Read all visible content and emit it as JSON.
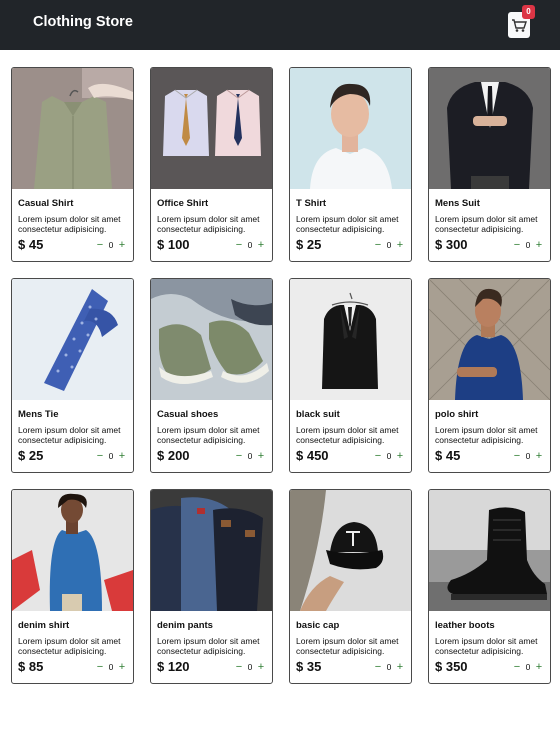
{
  "navbar": {
    "brand": "Clothing Store",
    "cart_count": "0",
    "cart_icon": "cart-icon"
  },
  "products": [
    {
      "name": "Casual Shirt",
      "desc": "Lorem ipsum dolor sit amet consectetur adipisicing.",
      "price": "$ 45",
      "qty": "0",
      "minus": "−",
      "plus": "+"
    },
    {
      "name": "Office Shirt",
      "desc": "Lorem ipsum dolor sit amet consectetur adipisicing.",
      "price": "$ 100",
      "qty": "0",
      "minus": "−",
      "plus": "+"
    },
    {
      "name": "T Shirt",
      "desc": "Lorem ipsum dolor sit amet consectetur adipisicing.",
      "price": "$ 25",
      "qty": "0",
      "minus": "−",
      "plus": "+"
    },
    {
      "name": "Mens Suit",
      "desc": "Lorem ipsum dolor sit amet consectetur adipisicing.",
      "price": "$ 300",
      "qty": "0",
      "minus": "−",
      "plus": "+"
    },
    {
      "name": "Mens Tie",
      "desc": "Lorem ipsum dolor sit amet consectetur adipisicing.",
      "price": "$ 25",
      "qty": "0",
      "minus": "−",
      "plus": "+"
    },
    {
      "name": "Casual shoes",
      "desc": "Lorem ipsum dolor sit amet consectetur adipisicing.",
      "price": "$ 200",
      "qty": "0",
      "minus": "−",
      "plus": "+"
    },
    {
      "name": "black suit",
      "desc": "Lorem ipsum dolor sit amet consectetur adipisicing.",
      "price": "$ 450",
      "qty": "0",
      "minus": "−",
      "plus": "+"
    },
    {
      "name": "polo shirt",
      "desc": "Lorem ipsum dolor sit amet consectetur adipisicing.",
      "price": "$ 45",
      "qty": "0",
      "minus": "−",
      "plus": "+"
    },
    {
      "name": "denim shirt",
      "desc": "Lorem ipsum dolor sit amet consectetur adipisicing.",
      "price": "$ 85",
      "qty": "0",
      "minus": "−",
      "plus": "+"
    },
    {
      "name": "denim pants",
      "desc": "Lorem ipsum dolor sit amet consectetur adipisicing.",
      "price": "$ 120",
      "qty": "0",
      "minus": "−",
      "plus": "+"
    },
    {
      "name": "basic cap",
      "desc": "Lorem ipsum dolor sit amet consectetur adipisicing.",
      "price": "$ 35",
      "qty": "0",
      "minus": "−",
      "plus": "+"
    },
    {
      "name": "leather boots",
      "desc": "Lorem ipsum dolor sit amet consectetur adipisicing.",
      "price": "$ 350",
      "qty": "0",
      "minus": "−",
      "plus": "+"
    }
  ],
  "colors": {
    "navbar": "#212529",
    "badge": "#dc3545",
    "qty_button": "#2e7d32"
  }
}
